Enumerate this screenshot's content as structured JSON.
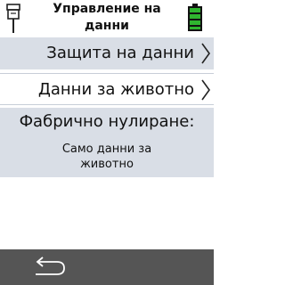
{
  "header": {
    "title": "Управление на данни",
    "device_icon": "device-icon",
    "battery_icon": "battery-icon",
    "battery_color": "#2fb52f"
  },
  "menu": {
    "items": [
      {
        "label": "Защита на данни",
        "icon": "chevron-right-icon"
      },
      {
        "label": "Данни за животно",
        "icon": "chevron-right-icon"
      }
    ]
  },
  "info": {
    "heading": "Фабрично нулиране:",
    "value": "Само данни за животно"
  },
  "footer": {
    "back_icon": "back-arrow-icon"
  },
  "colors": {
    "row_highlight": "#d9dee6",
    "footer_bg": "#555555"
  }
}
